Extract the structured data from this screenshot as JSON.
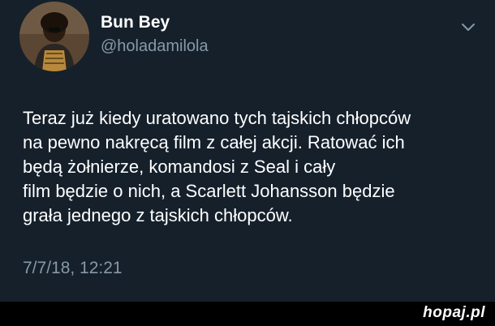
{
  "tweet": {
    "author_name": "Bun Bey",
    "author_handle": "@holadamilola",
    "text_lines": [
      "Teraz już kiedy uratowano tych tajskich chłopców",
      "na pewno nakręcą film z całej akcji. Ratować ich",
      "będą żołnierze, komandosi z Seal i cały",
      "film będzie o nich, a Scarlett Johansson będzie",
      "grała jednego z tajskich chłopców."
    ],
    "timestamp": "7/7/18, 12:21"
  },
  "footer": {
    "brand": "hopaj.pl"
  },
  "colors": {
    "background": "#15202b",
    "text": "#ffffff",
    "muted": "#8899a6",
    "footer": "#000000"
  },
  "icons": {
    "menu": "chevron-down-icon"
  }
}
